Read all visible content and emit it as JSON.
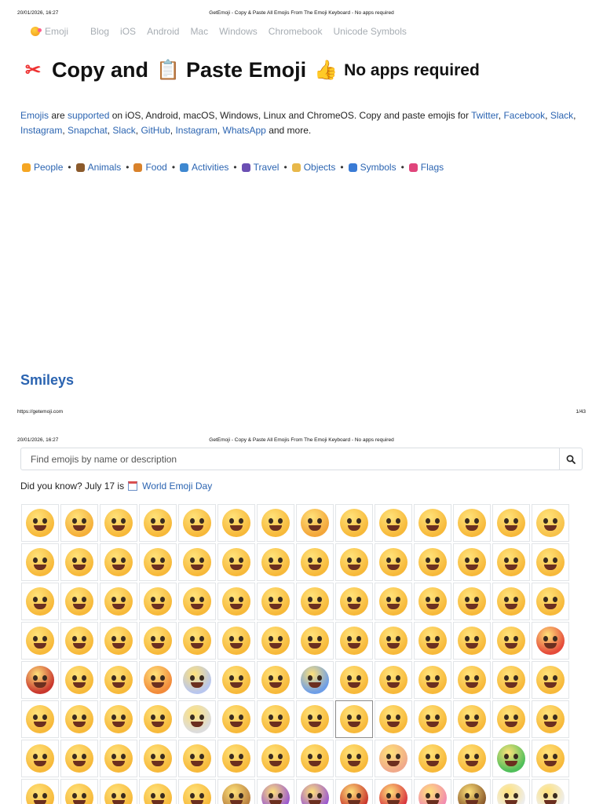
{
  "print": {
    "datetime": "20/01/2026, 16:27",
    "title": "GetEmoji - Copy & Paste All Emojis From The Emoji Keyboard - No apps required",
    "url": "https://getemoji.com",
    "page": "1/43"
  },
  "nav": {
    "brand": "Emoji",
    "items": [
      "Blog",
      "iOS",
      "Android",
      "Mac",
      "Windows",
      "Chromebook",
      "Unicode Symbols"
    ]
  },
  "hero": {
    "part1": "Copy and",
    "part2": "Paste Emoji",
    "part3": "No apps required",
    "icons": {
      "first": "scissors-icon",
      "second": "clipboard-icon",
      "third": "thumbs-up-icon"
    }
  },
  "intro": {
    "l_emojis": "Emojis",
    "t_are": " are ",
    "l_supported": "supported",
    "t_platforms": " on iOS, Android, macOS, Windows, Linux and ChromeOS. Copy and paste emojis for ",
    "l_twitter": "Twitter",
    "l_facebook": "Facebook",
    "l_slack": "Slack",
    "l_instagram": "Instagram",
    "l_snapchat": "Snapchat",
    "l_slack2": "Slack",
    "l_github": "GitHub",
    "l_instagram2": "Instagram",
    "l_whatsapp": "WhatsApp",
    "t_more": " and more.",
    "comma": ", "
  },
  "categories": [
    {
      "label": "People",
      "icon": "people-icon",
      "color": "#f5a623"
    },
    {
      "label": "Animals",
      "icon": "animals-icon",
      "color": "#8b5a2b"
    },
    {
      "label": "Food",
      "icon": "food-icon",
      "color": "#d9822b"
    },
    {
      "label": "Activities",
      "icon": "activities-icon",
      "color": "#3f88d0"
    },
    {
      "label": "Travel",
      "icon": "travel-icon",
      "color": "#6b4fb3"
    },
    {
      "label": "Objects",
      "icon": "objects-icon",
      "color": "#e8b84a"
    },
    {
      "label": "Symbols",
      "icon": "symbols-icon",
      "color": "#3a7bd5"
    },
    {
      "label": "Flags",
      "icon": "flags-icon",
      "color": "#e0457b"
    }
  ],
  "category_separator": "•",
  "section": {
    "title": "Smileys"
  },
  "search": {
    "placeholder": "Find emojis by name or description",
    "value": ""
  },
  "did_you_know": {
    "text": "Did you know? July 17 is",
    "link": "World Emoji Day"
  },
  "emoji_grid": {
    "rows": [
      [
        "#f7b93a",
        "#f5b03a",
        "#f7b93a",
        "#f7b93a",
        "#f7b93a",
        "#f7b93a",
        "#f7b93a",
        "#f3a63a",
        "#f7b93a",
        "#f7b93a",
        "#f7b93a",
        "#f7b93a",
        "#f7b93a",
        "#f7c24a"
      ],
      [
        "#f7b93a",
        "#f7b93a",
        "#f7b93a",
        "#f7b93a",
        "#f7b93a",
        "#f7b93a",
        "#f7b93a",
        "#f7b93a",
        "#f7b93a",
        "#f7b93a",
        "#f7b93a",
        "#f7b93a",
        "#f7b93a",
        "#f7b93a"
      ],
      [
        "#f7b93a",
        "#f7b93a",
        "#f7b93a",
        "#f7b93a",
        "#f7b93a",
        "#f7b93a",
        "#f7b93a",
        "#f7b93a",
        "#f7b93a",
        "#f7b93a",
        "#f7b93a",
        "#f7b93a",
        "#f7b93a",
        "#f7b93a"
      ],
      [
        "#f7b93a",
        "#f7b93a",
        "#f7b93a",
        "#f7b93a",
        "#f7b93a",
        "#f7b93a",
        "#f7b93a",
        "#f7b93a",
        "#f7b93a",
        "#f7b93a",
        "#f7b93a",
        "#f7b93a",
        "#f7b93a",
        "#e54a3a"
      ],
      [
        "#c9362d",
        "#f7b93a",
        "#f7b93a",
        "#f28a3a",
        "#b8c6ef",
        "#f7b93a",
        "#f7b93a",
        "#6d9ee8",
        "#f7b93a",
        "#f7b93a",
        "#f7b93a",
        "#f7b93a",
        "#f7b93a",
        "#f7b93a"
      ],
      [
        "#f7b93a",
        "#f7b93a",
        "#f7b93a",
        "#f7b93a",
        "#dcdcdc",
        "#f7b93a",
        "#f7b93a",
        "#f7b93a",
        "#f7b93a",
        "#f7b93a",
        "#f7b93a",
        "#f7b93a",
        "#f7b93a",
        "#f7b93a"
      ],
      [
        "#f7b93a",
        "#f7b93a",
        "#f7b93a",
        "#f7b93a",
        "#f7b93a",
        "#f7b93a",
        "#f7b93a",
        "#f7b93a",
        "#f7b93a",
        "#f0a98a",
        "#f7b93a",
        "#f7b93a",
        "#4fbf5a",
        "#f7b93a"
      ],
      [
        "#f7b93a",
        "#f7b93a",
        "#f7b93a",
        "#f7b93a",
        "#f7b93a",
        "#b9803f",
        "#9b59d0",
        "#9b59d0",
        "#c9362d",
        "#d9363f",
        "#f28bb0",
        "#8b5a2b",
        "#eeeeee",
        "#eeeeee"
      ]
    ],
    "selected": [
      5,
      8
    ]
  }
}
